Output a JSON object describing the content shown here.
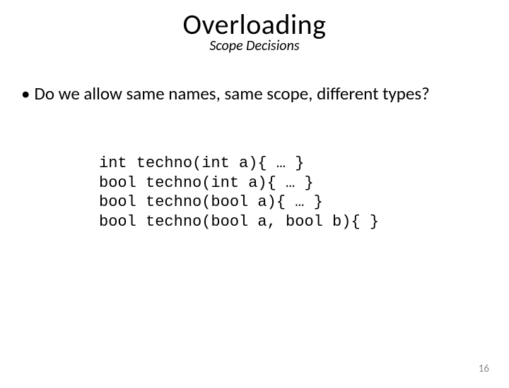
{
  "title": "Overloading",
  "subtitle": "Scope Decisions",
  "bullet": "Do we allow same names, same scope, different types?",
  "code": {
    "line1": "int techno(int a){ … }",
    "line2": "bool techno(int a){ … }",
    "line3": "bool techno(bool a){ … }",
    "line4": "bool techno(bool a, bool b){ }"
  },
  "page_number": "16"
}
